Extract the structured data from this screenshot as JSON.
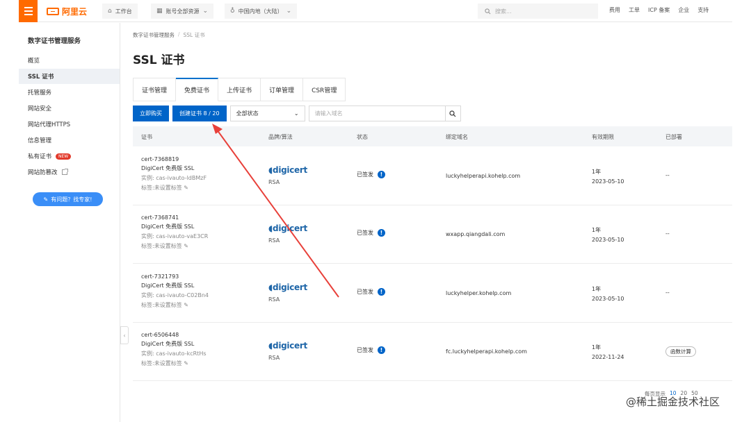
{
  "topbar": {
    "brand": "阿里云",
    "workbench": "工作台",
    "account_resources": "账号全部资源",
    "region": "中国内地（大陆）",
    "search_placeholder": "搜索...",
    "links": [
      "费用",
      "工单",
      "ICP 备案",
      "企业",
      "支持"
    ]
  },
  "sidebar": {
    "title": "数字证书管理服务",
    "items": [
      {
        "label": "概览"
      },
      {
        "label": "SSL 证书"
      },
      {
        "label": "托管服务"
      },
      {
        "label": "网站安全"
      },
      {
        "label": "网站代理HTTPS"
      },
      {
        "label": "信息管理"
      },
      {
        "label": "私有证书"
      },
      {
        "label": "网站防篡改"
      }
    ],
    "new_badge": "NEW",
    "expert_button": "有问题？找专家!"
  },
  "breadcrumb": [
    "数字证书管理服务",
    "SSL 证书"
  ],
  "page_title": "SSL 证书",
  "tabs": [
    "证书管理",
    "免费证书",
    "上传证书",
    "订单管理",
    "CSR管理"
  ],
  "toolbar": {
    "buy": "立即购买",
    "create": "创建证书 8 / 20",
    "status_select": "全部状态",
    "domain_placeholder": "请输入域名"
  },
  "table": {
    "headers": [
      "证书",
      "品牌/算法",
      "状态",
      "绑定域名",
      "有效期限",
      "已部署"
    ],
    "rows": [
      {
        "id": "cert-7368819",
        "name": "DigiCert 免费版 SSL",
        "instance": "实例: cas-ivauto-ldBMzF",
        "tag": "标签:未设置标签",
        "brand": "digicert",
        "algo": "RSA",
        "status": "已签发",
        "domain": "luckyhelperapi.kohelp.com",
        "term": "1年",
        "expire": "2023-05-10",
        "deployed": "--"
      },
      {
        "id": "cert-7368741",
        "name": "DigiCert 免费版 SSL",
        "instance": "实例: cas-ivauto-vaE3CR",
        "tag": "标签:未设置标签",
        "brand": "digicert",
        "algo": "RSA",
        "status": "已签发",
        "domain": "wxapp.qiangdali.com",
        "term": "1年",
        "expire": "2023-05-10",
        "deployed": "--"
      },
      {
        "id": "cert-7321793",
        "name": "DigiCert 免费版 SSL",
        "instance": "实例: cas-ivauto-C02Bn4",
        "tag": "标签:未设置标签",
        "brand": "digicert",
        "algo": "RSA",
        "status": "已签发",
        "domain": "luckyhelper.kohelp.com",
        "term": "1年",
        "expire": "2023-05-10",
        "deployed": "--"
      },
      {
        "id": "cert-6506448",
        "name": "DigiCert 免费版 SSL",
        "instance": "实例: cas-ivauto-kcRtHs",
        "tag": "标签:未设置标签",
        "brand": "digicert",
        "algo": "RSA",
        "status": "已签发",
        "domain": "fc.luckyhelperapi.kohelp.com",
        "term": "1年",
        "expire": "2022-11-24",
        "deployed": "函数计算"
      }
    ]
  },
  "pager": {
    "label": "每页显示",
    "sizes": [
      "10",
      "20",
      "50"
    ]
  },
  "watermark": "@稀土掘金技术社区",
  "colors": {
    "brand": "#ff6a00",
    "primary": "#0064c8",
    "annotation_arrow": "#e8403a"
  }
}
